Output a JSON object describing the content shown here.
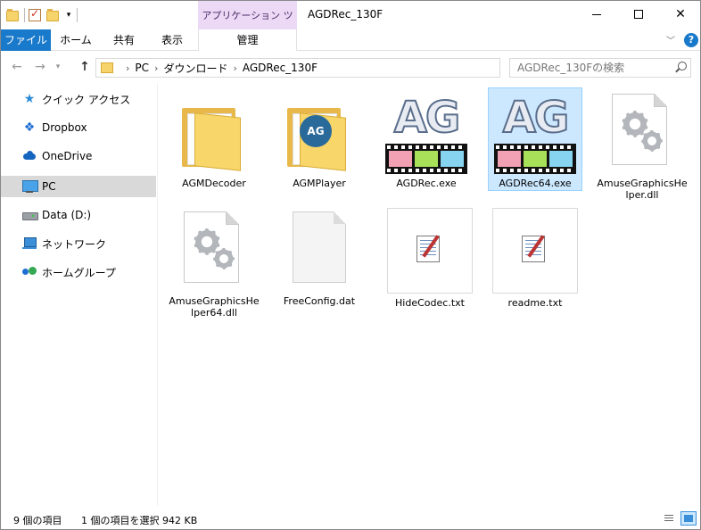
{
  "window": {
    "title": "AGDRec_130F",
    "contextual_tab_header": "アプリケーション ツール"
  },
  "ribbon": {
    "tabs": [
      {
        "label": "ファイル"
      },
      {
        "label": "ホーム"
      },
      {
        "label": "共有"
      },
      {
        "label": "表示"
      },
      {
        "label": "管理"
      }
    ],
    "help_label": "?"
  },
  "address": {
    "crumbs": [
      "PC",
      "ダウンロード",
      "AGDRec_130F"
    ],
    "search_placeholder": "AGDRec_130Fの検索"
  },
  "nav_pane": {
    "items": [
      {
        "label": "クイック アクセス",
        "icon": "star-icon"
      },
      {
        "label": "Dropbox",
        "icon": "dropbox-icon"
      },
      {
        "label": "OneDrive",
        "icon": "onedrive-icon"
      },
      {
        "label": "PC",
        "icon": "pc-icon",
        "selected": true
      },
      {
        "label": "Data (D:)",
        "icon": "drive-icon"
      },
      {
        "label": "ネットワーク",
        "icon": "network-icon"
      },
      {
        "label": "ホームグループ",
        "icon": "homegroup-icon"
      }
    ]
  },
  "files": [
    {
      "name": "AGMDecoder",
      "type": "folder"
    },
    {
      "name": "AGMPlayer",
      "type": "folder"
    },
    {
      "name": "AGDRec.exe",
      "type": "exe"
    },
    {
      "name": "AGDRec64.exe",
      "type": "exe",
      "selected": true
    },
    {
      "name": "AmuseGraphicsHelper.dll",
      "type": "dll"
    },
    {
      "name": "AmuseGraphicsHelper64.dll",
      "type": "dll"
    },
    {
      "name": "FreeConfig.dat",
      "type": "dat"
    },
    {
      "name": "HideCodec.txt",
      "type": "txt"
    },
    {
      "name": "readme.txt",
      "type": "txt"
    }
  ],
  "exe_icon_text": "AG",
  "folder_badge_text": "AG",
  "status": {
    "item_count": "9 個の項目",
    "selection": "1 個の項目を選択  942 KB"
  },
  "colors": {
    "accent": "#1979ca",
    "selection": "#cce8ff",
    "contextual": "#ecd9f5"
  }
}
